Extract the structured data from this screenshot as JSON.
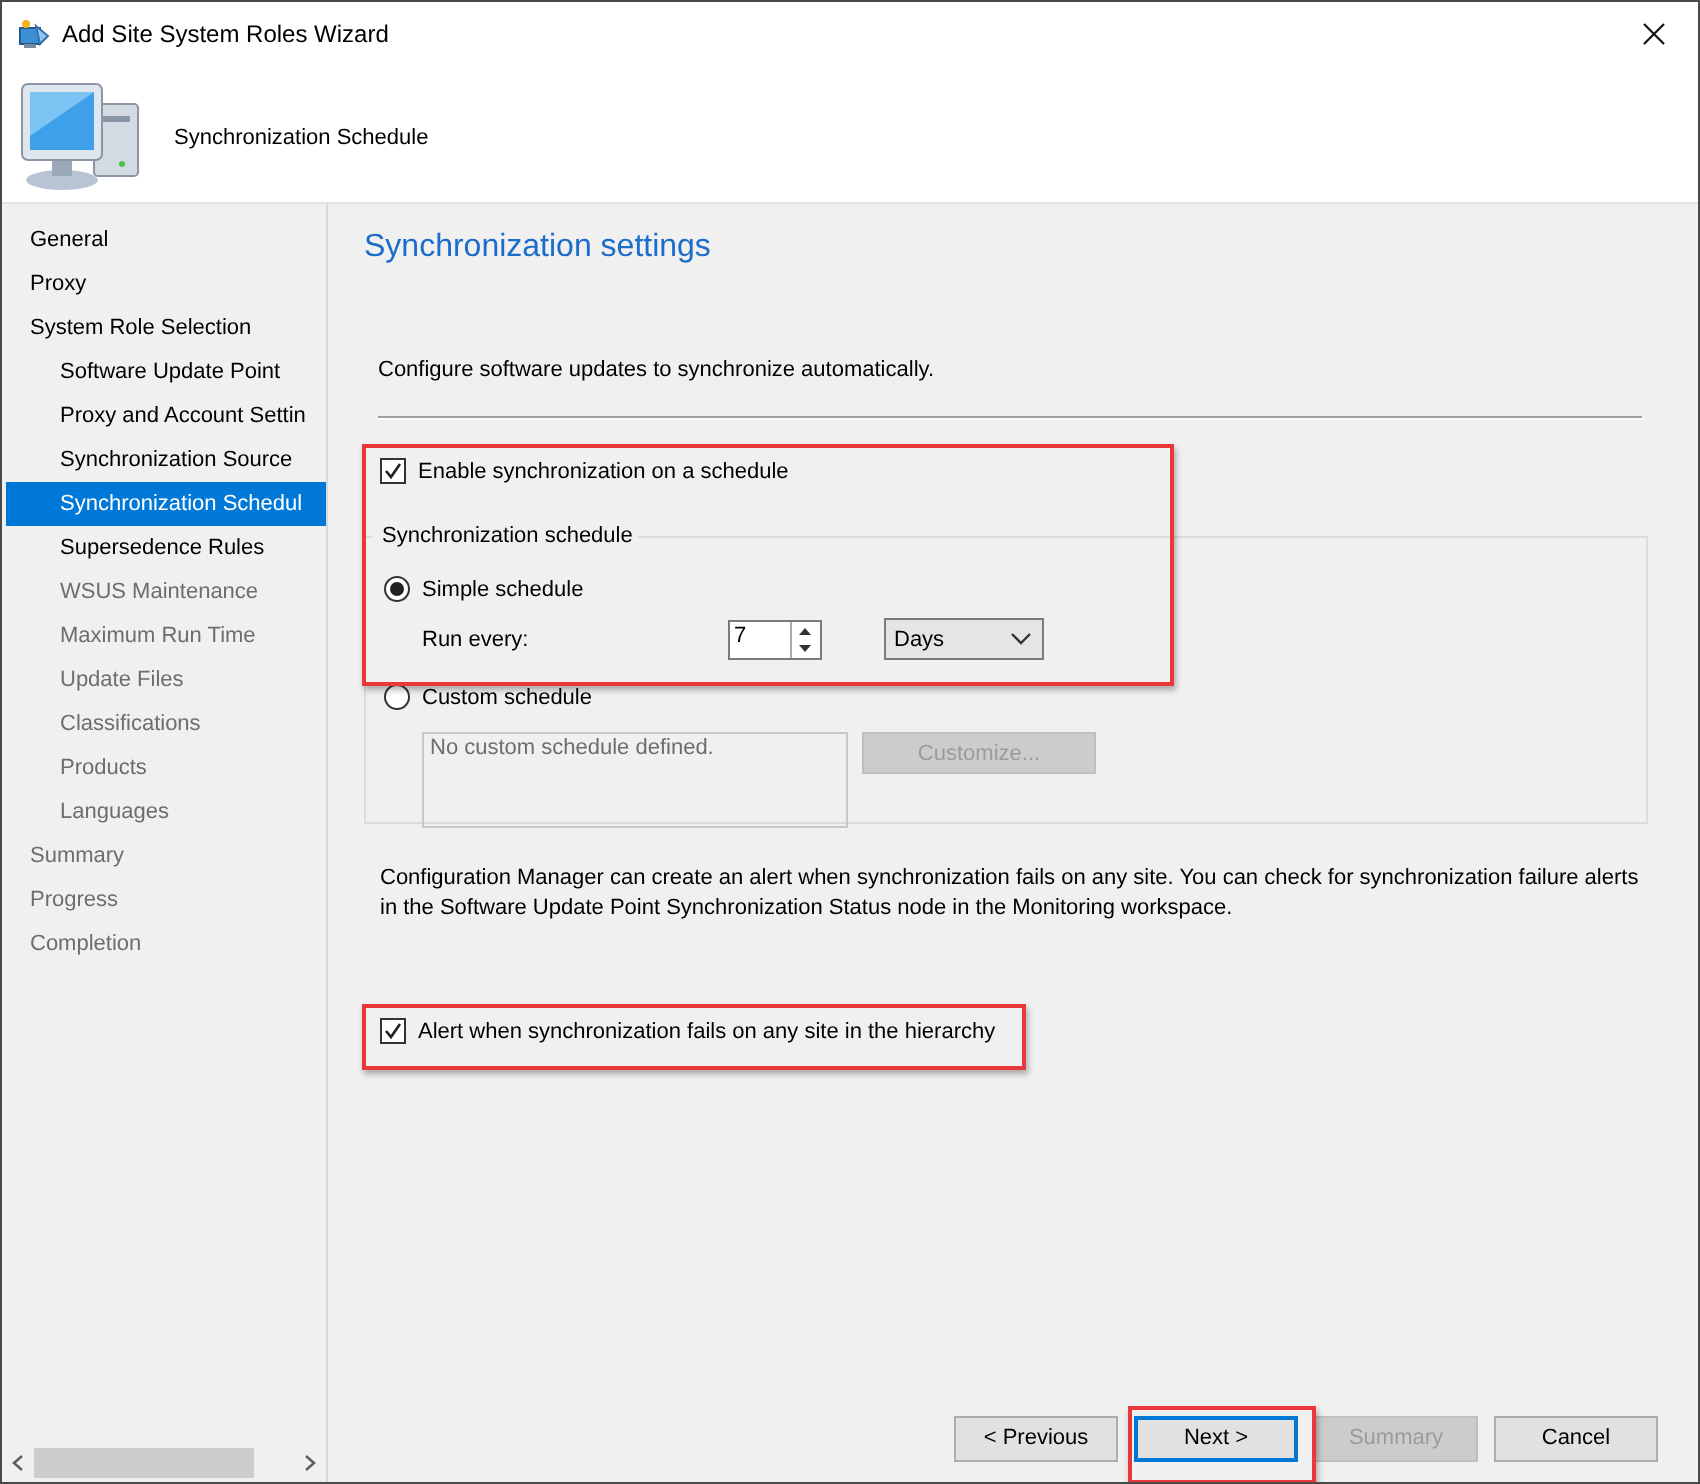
{
  "window": {
    "title": "Add Site System Roles Wizard"
  },
  "header": {
    "title": "Synchronization Schedule"
  },
  "sidebar": {
    "items": [
      {
        "label": "General",
        "selected": false,
        "disabled": false
      },
      {
        "label": "Proxy",
        "selected": false,
        "disabled": false
      },
      {
        "label": "System Role Selection",
        "selected": false,
        "disabled": false,
        "children": [
          {
            "label": "Software Update Point",
            "selected": false,
            "disabled": false
          },
          {
            "label": "Proxy and Account Settin",
            "selected": false,
            "disabled": false
          },
          {
            "label": "Synchronization Source",
            "selected": false,
            "disabled": false
          },
          {
            "label": "Synchronization Schedul",
            "selected": true,
            "disabled": false
          },
          {
            "label": "Supersedence Rules",
            "selected": false,
            "disabled": false
          },
          {
            "label": "WSUS Maintenance",
            "selected": false,
            "disabled": true
          },
          {
            "label": "Maximum Run Time",
            "selected": false,
            "disabled": true
          },
          {
            "label": "Update Files",
            "selected": false,
            "disabled": true
          },
          {
            "label": "Classifications",
            "selected": false,
            "disabled": true
          },
          {
            "label": "Products",
            "selected": false,
            "disabled": true
          },
          {
            "label": "Languages",
            "selected": false,
            "disabled": true
          }
        ]
      },
      {
        "label": "Summary",
        "selected": false,
        "disabled": true
      },
      {
        "label": "Progress",
        "selected": false,
        "disabled": true
      },
      {
        "label": "Completion",
        "selected": false,
        "disabled": true
      }
    ]
  },
  "page": {
    "heading": "Synchronization settings",
    "description": "Configure software updates to synchronize automatically.",
    "enable_checkbox": {
      "label": "Enable synchronization on a schedule",
      "checked": true,
      "highlighted": true
    },
    "schedule_group": {
      "label": "Synchronization schedule",
      "options": [
        {
          "kind": "simple",
          "label": "Simple schedule",
          "selected": true,
          "run_every_label": "Run every:",
          "interval": "7",
          "unit": "Days"
        },
        {
          "kind": "custom",
          "label": "Custom schedule",
          "selected": false,
          "schedule_text": "No custom schedule defined.",
          "customize_button": {
            "label": "Customize...",
            "disabled": true
          }
        }
      ]
    },
    "info": "Configuration Manager can create an alert when synchronization fails on any site. You can check for synchronization failure alerts in the Software Update Point Synchronization Status node in the Monitoring workspace.",
    "alert_checkbox": {
      "label": "Alert when synchronization fails on any site in the hierarchy",
      "checked": true,
      "highlighted": true
    }
  },
  "buttons": [
    {
      "label": "< Previous",
      "disabled": false,
      "focused": false,
      "highlighted": false
    },
    {
      "label": "Next >",
      "disabled": false,
      "focused": true,
      "highlighted": true
    },
    {
      "label": "Summary",
      "disabled": true,
      "focused": false,
      "highlighted": false
    },
    {
      "label": "Cancel",
      "disabled": false,
      "focused": false,
      "highlighted": false
    }
  ]
}
